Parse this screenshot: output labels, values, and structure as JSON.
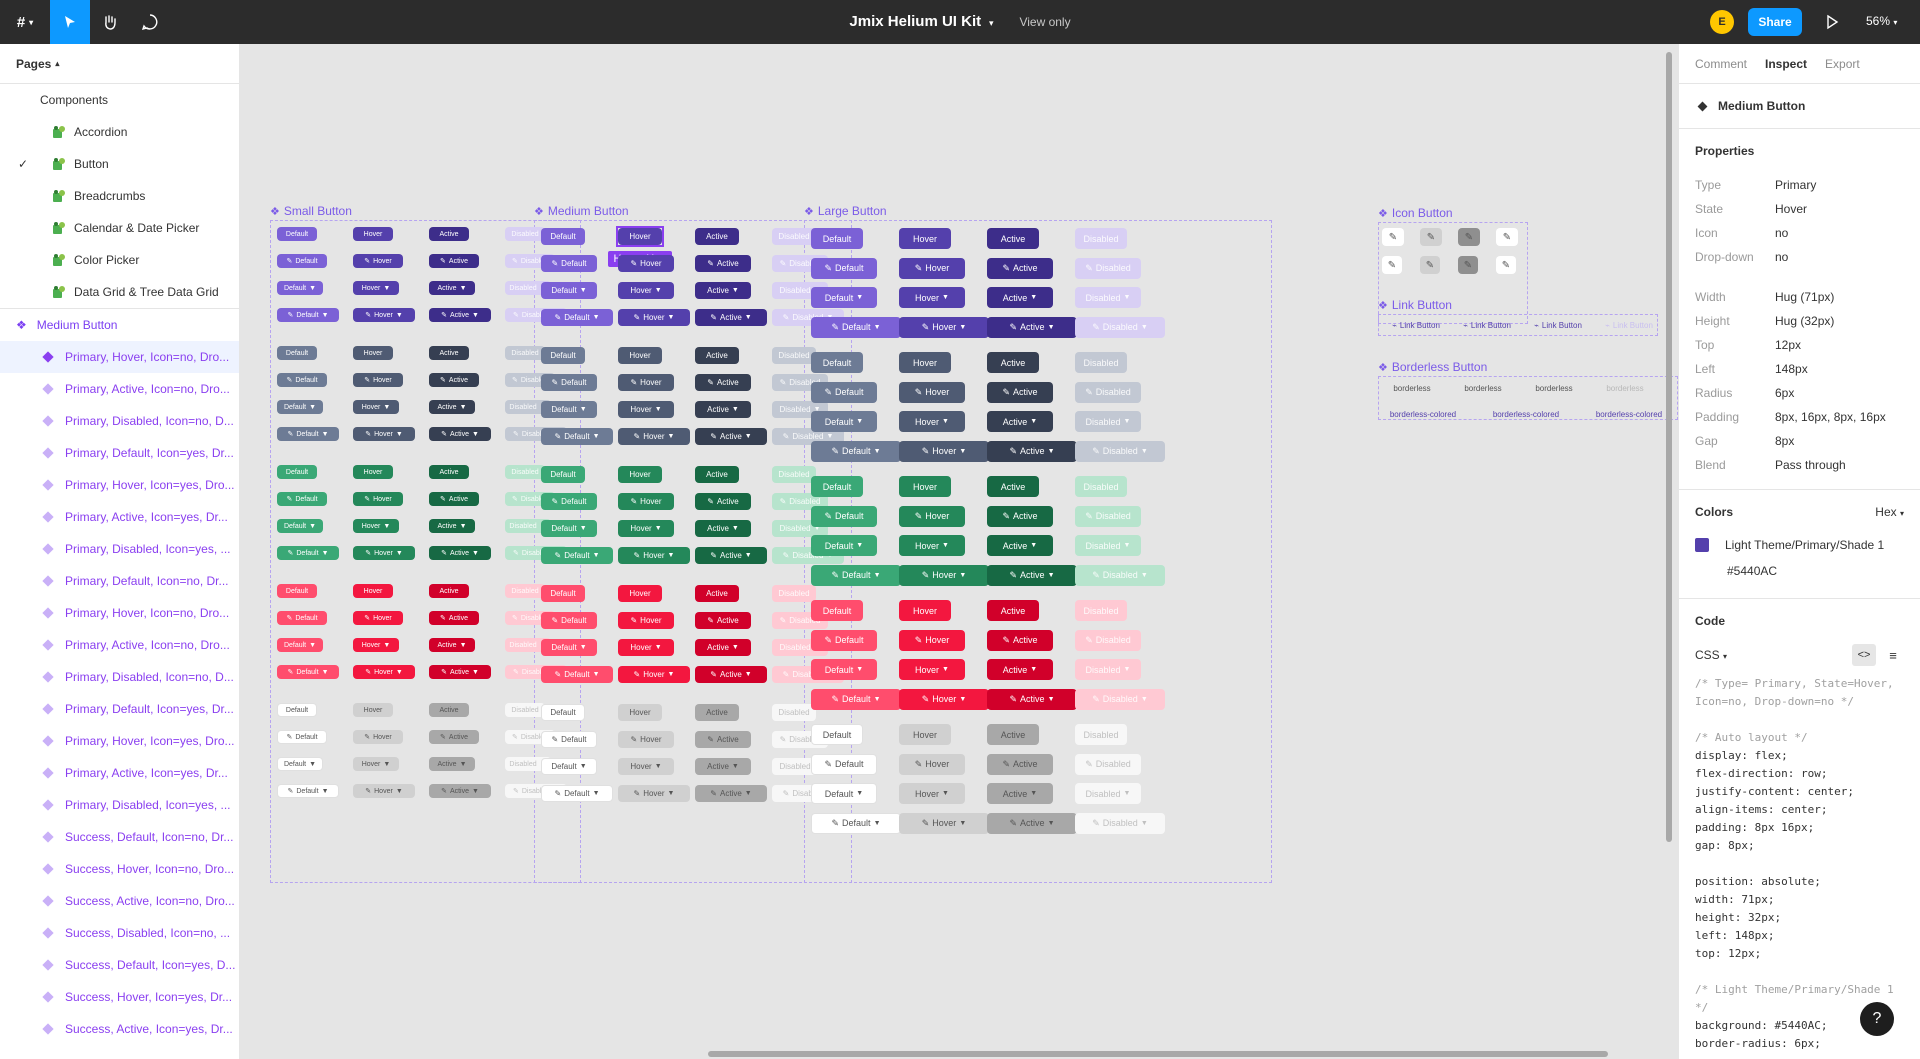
{
  "topbar": {
    "logo": "#",
    "title": "Jmix Helium UI Kit",
    "view_mode": "View only",
    "avatar_initial": "E",
    "share_label": "Share",
    "zoom": "56%"
  },
  "left_panel": {
    "pages_label": "Pages",
    "section_label": "Components",
    "pages": [
      {
        "label": "Accordion",
        "checked": false
      },
      {
        "label": "Button",
        "checked": true
      },
      {
        "label": "Breadcrumbs",
        "checked": false
      },
      {
        "label": "Calendar & Date Picker",
        "checked": false
      },
      {
        "label": "Color Picker",
        "checked": false
      },
      {
        "label": "Data Grid & Tree Data Grid",
        "checked": false
      }
    ],
    "layer_top": "Medium Button",
    "layers": [
      "Primary, Hover, Icon=no, Dro...",
      "Primary, Active, Icon=no, Dro...",
      "Primary, Disabled, Icon=no, D...",
      "Primary, Default, Icon=yes, Dr...",
      "Primary, Hover, Icon=yes, Dro...",
      "Primary, Active, Icon=yes, Dr...",
      "Primary, Disabled, Icon=yes, ...",
      "Primary, Default, Icon=no, Dr...",
      "Primary, Hover, Icon=no, Dro...",
      "Primary, Active, Icon=no, Dro...",
      "Primary, Disabled, Icon=no, D...",
      "Primary, Default, Icon=yes, Dr...",
      "Primary, Hover, Icon=yes, Dro...",
      "Primary, Active, Icon=yes, Dr...",
      "Primary, Disabled, Icon=yes, ...",
      "Success, Default, Icon=no, Dr...",
      "Success, Hover, Icon=no, Dro...",
      "Success, Active, Icon=no, Dro...",
      "Success, Disabled, Icon=no, ...",
      "Success, Default, Icon=yes, D...",
      "Success, Hover, Icon=yes, Dr...",
      "Success, Active, Icon=yes, Dr..."
    ]
  },
  "right_panel": {
    "tabs": [
      "Comment",
      "Inspect",
      "Export"
    ],
    "active_tab": "Inspect",
    "component_name": "Medium Button",
    "properties_label": "Properties",
    "props1": [
      {
        "k": "Type",
        "v": "Primary"
      },
      {
        "k": "State",
        "v": "Hover"
      },
      {
        "k": "Icon",
        "v": "no"
      },
      {
        "k": "Drop-down",
        "v": "no"
      }
    ],
    "props2": [
      {
        "k": "Width",
        "v": "Hug (71px)"
      },
      {
        "k": "Height",
        "v": "Hug (32px)"
      },
      {
        "k": "Top",
        "v": "12px"
      },
      {
        "k": "Left",
        "v": "148px"
      },
      {
        "k": "Radius",
        "v": "6px"
      },
      {
        "k": "Padding",
        "v": "8px, 16px, 8px, 16px"
      },
      {
        "k": "Gap",
        "v": "8px"
      },
      {
        "k": "Blend",
        "v": "Pass through"
      }
    ],
    "colors_label": "Colors",
    "color_format": "Hex",
    "color_name": "Light Theme/Primary/Shade 1",
    "color_hex": "#5440AC",
    "code_label": "Code",
    "code_lang": "CSS",
    "code_lines": [
      "/* Type= Primary, State=Hover,",
      "Icon=no, Drop-down=no */",
      "",
      "/* Auto layout */",
      "display: flex;",
      "flex-direction: row;",
      "justify-content: center;",
      "align-items: center;",
      "padding: 8px 16px;",
      "gap: 8px;",
      "",
      "position: absolute;",
      "width: 71px;",
      "height: 32px;",
      "left: 148px;",
      "top: 12px;",
      "",
      "/* Light Theme/Primary/Shade 1",
      "*/",
      "background: #5440AC;",
      "border-radius: 6px;"
    ]
  },
  "canvas": {
    "frames": {
      "small": "Small Button",
      "medium": "Medium Button",
      "large": "Large Button",
      "icon": "Icon Button",
      "link": "Link Button",
      "borderless": "Borderless Button"
    },
    "states": [
      "Default",
      "Hover",
      "Active",
      "Disabled"
    ],
    "link_label": "Link Button",
    "borderless_label": "borderless",
    "borderless_colored_label": "borderless-colored",
    "hug_label": "Hug × Hug",
    "palette": {
      "primary": [
        "#7b61d6",
        "#5440ac",
        "#3d2d8a",
        "#d8cff4"
      ],
      "neutral": [
        "#6d7b95",
        "#4f5b73",
        "#363f52",
        "#c2c8d3"
      ],
      "success": [
        "#3aa876",
        "#24885a",
        "#176944",
        "#b7e4cd"
      ],
      "danger": [
        "#ff4d6d",
        "#f3173f",
        "#d1002a",
        "#ffc9d3"
      ],
      "light": [
        "#ffffff",
        "#d0d0d0",
        "#a8a8a8",
        "#f7f7f7"
      ]
    }
  }
}
